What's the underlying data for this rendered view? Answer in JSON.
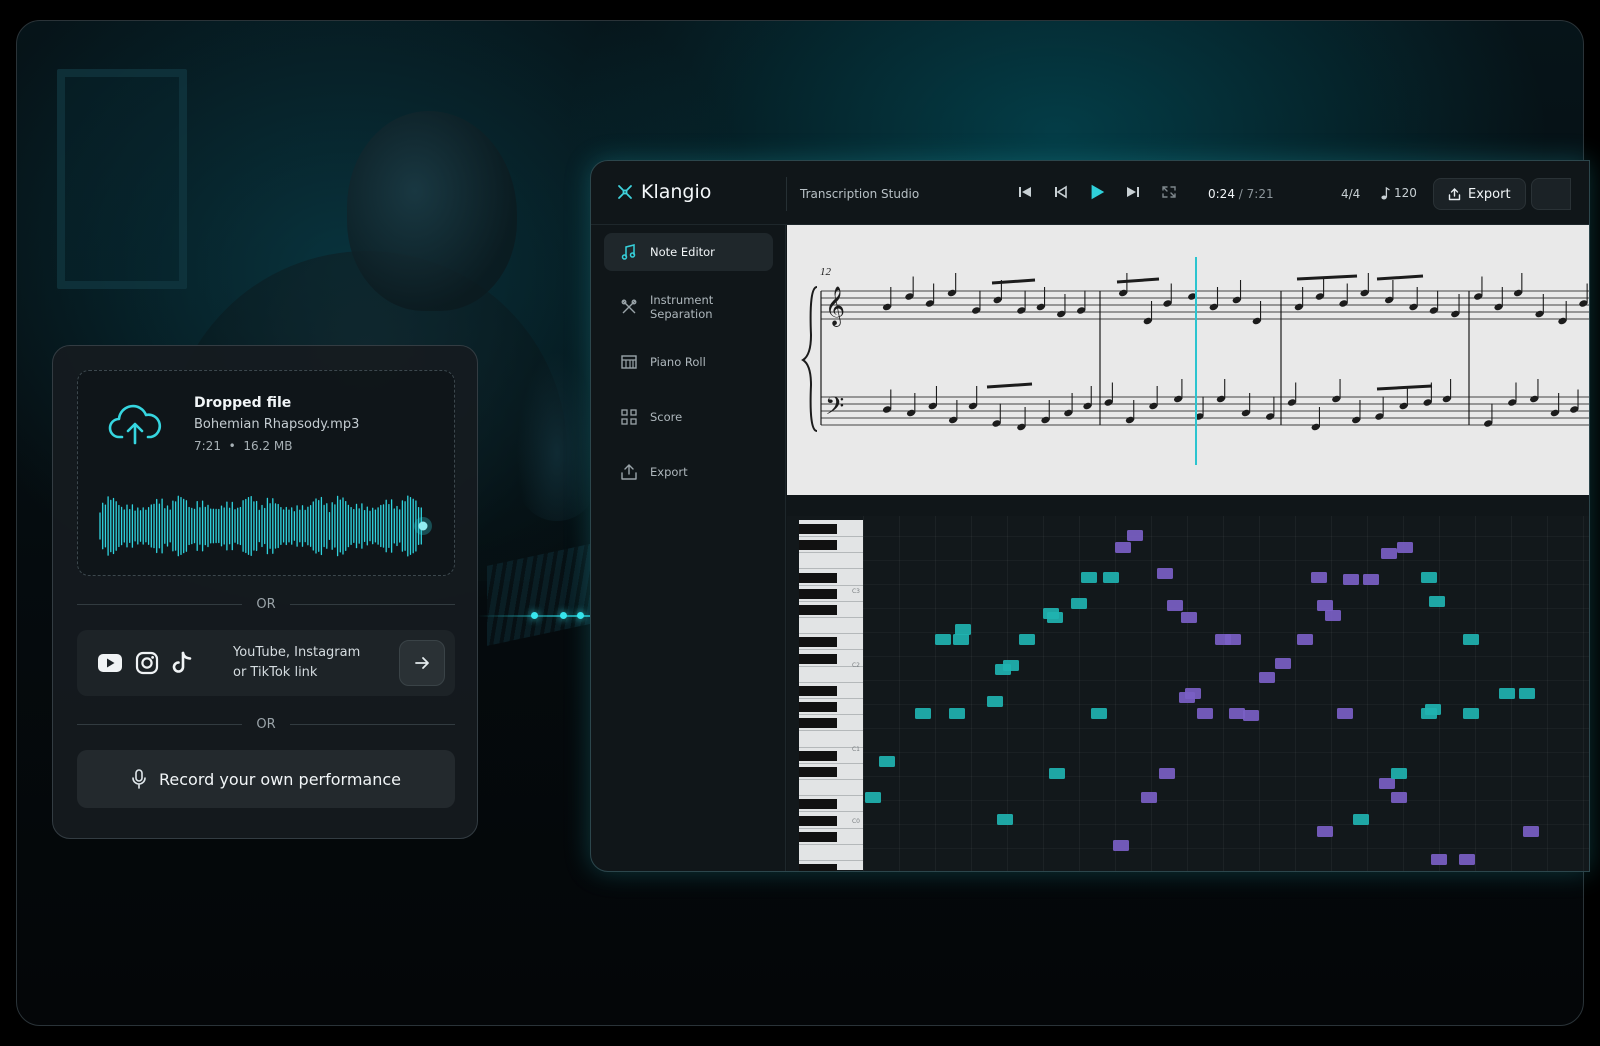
{
  "upload": {
    "title": "Dropped file",
    "filename": "Bohemian Rhapsody.mp3",
    "duration": "7:21",
    "separator": "•",
    "size": "16.2 MB",
    "or_label": "OR",
    "link_line1": "YouTube, Instagram",
    "link_line2": "or TikTok link",
    "record_label": "Record your own performance"
  },
  "app": {
    "brand": "Klangio",
    "studio": "Transcription Studio",
    "time_current": "0:24",
    "time_total": "/ 7:21",
    "meter": "4/4",
    "tempo": "120",
    "export_label": "Export",
    "measure_number": "12",
    "nav": [
      {
        "label": "Note Editor",
        "icon": "note-editor-icon",
        "active": true
      },
      {
        "label": "Instrument Separation",
        "icon": "instrument-separation-icon",
        "active": false
      },
      {
        "label": "Piano Roll",
        "icon": "piano-roll-icon",
        "active": false
      },
      {
        "label": "Score",
        "icon": "score-icon",
        "active": false
      },
      {
        "label": "Export",
        "icon": "export-icon",
        "active": false
      }
    ],
    "key_labels": [
      "C3",
      "C2",
      "C1",
      "C0"
    ]
  },
  "colors": {
    "accent": "#2fc7d2",
    "note_teal": "#1fb3b0",
    "note_purple": "#7a5fc4",
    "playhead": "#2bc4cf"
  }
}
